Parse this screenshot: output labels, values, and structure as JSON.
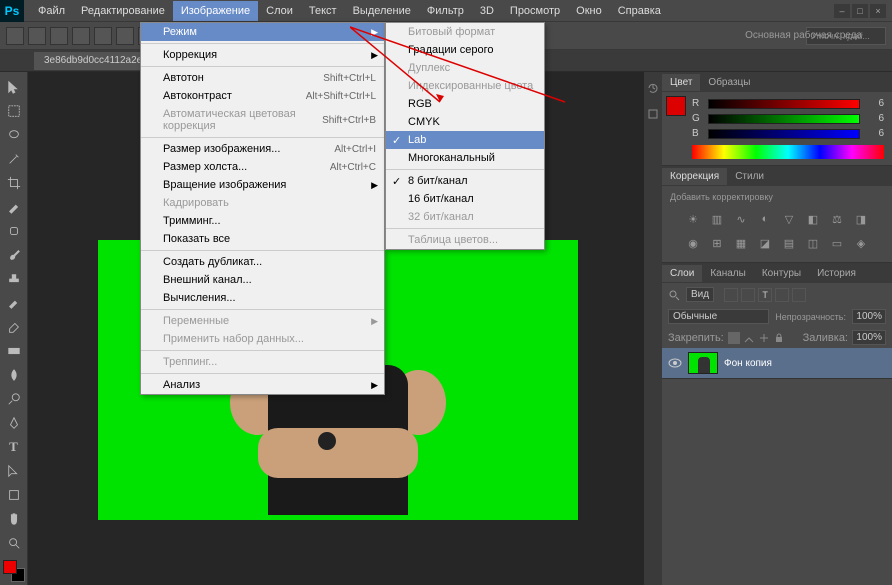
{
  "menubar": {
    "items": [
      "Файл",
      "Редактирование",
      "Изображение",
      "Слои",
      "Текст",
      "Выделение",
      "Фильтр",
      "3D",
      "Просмотр",
      "Окно",
      "Справка"
    ],
    "active_index": 2
  },
  "document_tab": "3e86db9d0cc4112a2e4d3c8...",
  "find_placeholder": "Уточн. край...",
  "workspace": "Основная рабочая среда",
  "dropdown_main": [
    {
      "label": "Режим",
      "hl": true,
      "submenu": true
    },
    {
      "label": "Коррекция",
      "submenu": true,
      "sep": true
    },
    {
      "label": "Автотон",
      "shortcut": "Shift+Ctrl+L",
      "sep": true
    },
    {
      "label": "Автоконтраст",
      "shortcut": "Alt+Shift+Ctrl+L"
    },
    {
      "label": "Автоматическая цветовая коррекция",
      "shortcut": "Shift+Ctrl+B",
      "disabled": true
    },
    {
      "label": "Размер изображения...",
      "shortcut": "Alt+Ctrl+I",
      "sep": true
    },
    {
      "label": "Размер холста...",
      "shortcut": "Alt+Ctrl+C"
    },
    {
      "label": "Вращение изображения",
      "submenu": true
    },
    {
      "label": "Кадрировать",
      "disabled": true
    },
    {
      "label": "Тримминг..."
    },
    {
      "label": "Показать все"
    },
    {
      "label": "Создать дубликат...",
      "sep": true
    },
    {
      "label": "Внешний канал..."
    },
    {
      "label": "Вычисления..."
    },
    {
      "label": "Переменные",
      "submenu": true,
      "disabled": true,
      "sep": true
    },
    {
      "label": "Применить набор данных...",
      "disabled": true
    },
    {
      "label": "Треппинг...",
      "disabled": true,
      "sep": true
    },
    {
      "label": "Анализ",
      "submenu": true,
      "sep": true
    }
  ],
  "dropdown_sub": [
    {
      "label": "Битовый формат",
      "disabled": true
    },
    {
      "label": "Градации серого"
    },
    {
      "label": "Дуплекс",
      "disabled": true
    },
    {
      "label": "Индексированные цвета",
      "disabled": true
    },
    {
      "label": "RGB"
    },
    {
      "label": "CMYK"
    },
    {
      "label": "Lab",
      "hl": true,
      "checked": true
    },
    {
      "label": "Многоканальный"
    },
    {
      "label": "8 бит/канал",
      "checked": true,
      "sep": true
    },
    {
      "label": "16 бит/канал"
    },
    {
      "label": "32 бит/канал",
      "disabled": true
    },
    {
      "label": "Таблица цветов...",
      "disabled": true,
      "sep": true
    }
  ],
  "panels": {
    "color": {
      "tabs": [
        "Цвет",
        "Образцы"
      ],
      "sliders": [
        {
          "ch": "R",
          "val": "6"
        },
        {
          "ch": "G",
          "val": "6"
        },
        {
          "ch": "B",
          "val": "6"
        }
      ]
    },
    "adjustments": {
      "tabs": [
        "Коррекция",
        "Стили"
      ],
      "hint": "Добавить корректировку"
    },
    "layers": {
      "tabs": [
        "Слои",
        "Каналы",
        "Контуры",
        "История"
      ],
      "kind": "Вид",
      "blend": "Обычные",
      "opacity_label": "Непрозрачность:",
      "opacity": "100%",
      "lock_label": "Закрепить:",
      "fill_label": "Заливка:",
      "fill": "100%",
      "layer_name": "Фон копия"
    }
  },
  "colors": {
    "fg": "#dd0000",
    "bg": "#000000",
    "canvas_bg": "#00e300"
  }
}
